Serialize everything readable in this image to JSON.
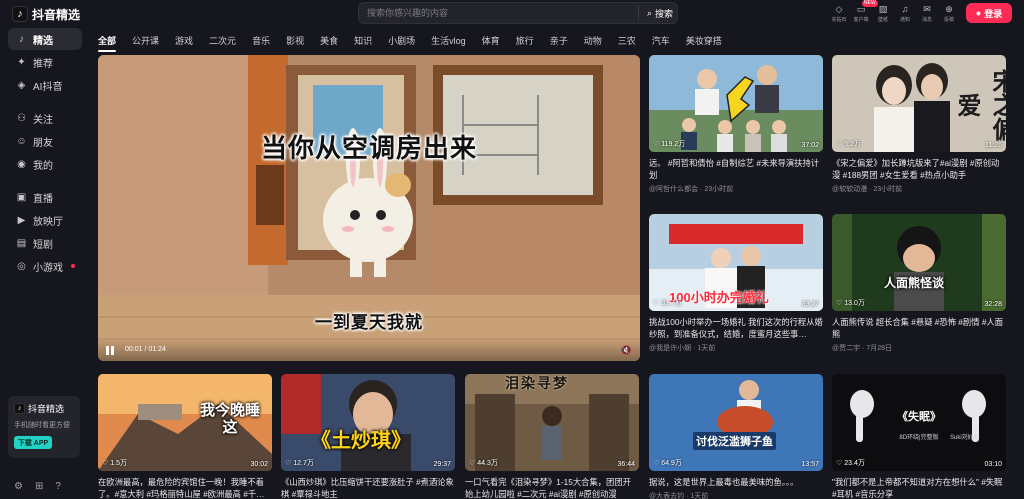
{
  "brand": {
    "name": "抖音精选"
  },
  "sidebar": {
    "items": [
      {
        "label": "精选",
        "icon": "douyin-icon",
        "active": true
      },
      {
        "label": "推荐",
        "icon": "sparkle-icon"
      },
      {
        "label": "AI抖音",
        "icon": "ai-icon"
      },
      {
        "label": "关注",
        "icon": "follow-icon"
      },
      {
        "label": "朋友",
        "icon": "friends-icon"
      },
      {
        "label": "我的",
        "icon": "profile-icon"
      },
      {
        "label": "直播",
        "icon": "live-icon"
      },
      {
        "label": "放映厅",
        "icon": "cinema-icon"
      },
      {
        "label": "短剧",
        "icon": "drama-icon"
      },
      {
        "label": "小游戏",
        "icon": "game-icon"
      }
    ],
    "promo": {
      "title": "抖音精选",
      "subtitle": "手机随时看更方便",
      "button": "下载 APP"
    }
  },
  "search": {
    "placeholder": "搜索你感兴趣的内容",
    "button": "搜索"
  },
  "header_tools": [
    {
      "label": "充钻石",
      "icon": "diamond-icon"
    },
    {
      "label": "客户端",
      "icon": "desktop-icon",
      "badge": "NEW"
    },
    {
      "label": "壁纸",
      "icon": "wallpaper-icon"
    },
    {
      "label": "通知",
      "icon": "bell-icon"
    },
    {
      "label": "消息",
      "icon": "message-icon"
    },
    {
      "label": "投稿",
      "icon": "upload-icon"
    }
  ],
  "login": "登录",
  "tabs": [
    "全部",
    "公开课",
    "游戏",
    "二次元",
    "音乐",
    "影视",
    "美食",
    "知识",
    "小剧场",
    "生活vlog",
    "体育",
    "旅行",
    "亲子",
    "动物",
    "三农",
    "汽车",
    "美妆穿搭"
  ],
  "hero": {
    "caption_top": "当你从空调房出来",
    "caption_bottom": "一到夏天我就",
    "time": "00:01 / 01:24"
  },
  "cards": [
    {
      "likes": "119.2万",
      "duration": "37:02",
      "title": "远。 #阿哲和倩怡 #自制综艺 #未来导演扶持计划",
      "author": "@阿哲什么都会 · 23小时前"
    },
    {
      "likes": "5.2万",
      "duration": "11:26",
      "title": "《宋之偏爱》加长蹲坑版来了#ai漫剧 #原创动漫 #188男团 #女生爱看 #热点小助手",
      "author": "@软软动漫 · 23小时前",
      "overlay": "宋之偏爱"
    },
    {
      "likes": "31.7万",
      "duration": "39:27",
      "title": "挑战100小时举办一场婚礼 我们这次的行程从婚纱照，到准备仪式，结婚，度蜜月这些事…",
      "author": "@我是许小娴 · 1天前",
      "overlay": "100小时办完婚礼"
    },
    {
      "likes": "13.0万",
      "duration": "32:28",
      "title": "人面熊传说 超长合集 #悬疑 #恐怖 #剧情 #人面熊",
      "author": "@贾二宇 · 7月28日",
      "overlay": "人面熊怪谈"
    },
    {
      "likes": "1.5万",
      "duration": "30:02",
      "title": "在欧洲最高，最危险的宾馆住一晚！我睡不着了。#意大利 #玛格丽特山屋 #欧洲最高 #千…",
      "author": "",
      "overlay": "我今晚睡这"
    },
    {
      "likes": "12.7万",
      "duration": "29:37",
      "title": "《山西炒琪》比压缩饼干还要涨肚子 #煮酒论象棋 #覃禄斗地主",
      "author": "",
      "overlay": "《土炒琪》"
    },
    {
      "likes": "44.3万",
      "duration": "36:44",
      "title": "一口气看完《泪染寻梦》1-15大合集，团团开始上幼儿园啦 #二次元 #ai漫剧 #原创动漫",
      "author": "",
      "overlay": "泪染寻梦"
    },
    {
      "likes": "64.9万",
      "duration": "13:57",
      "title": "据说，这是世界上最毒也最美味的鱼。。。",
      "author": "@大表去钓 · 1天前",
      "overlay": "讨伐泛滥狮子鱼"
    },
    {
      "likes": "23.4万",
      "duration": "03:10",
      "title": "\"我们都不是上帝都不知道对方在想什么\" #失眠 #耳机 #音乐分享",
      "author": "",
      "overlay": "《失眠》",
      "overlay2": "8D环绕|完整版",
      "overlay3": "Suki刘好好"
    }
  ]
}
